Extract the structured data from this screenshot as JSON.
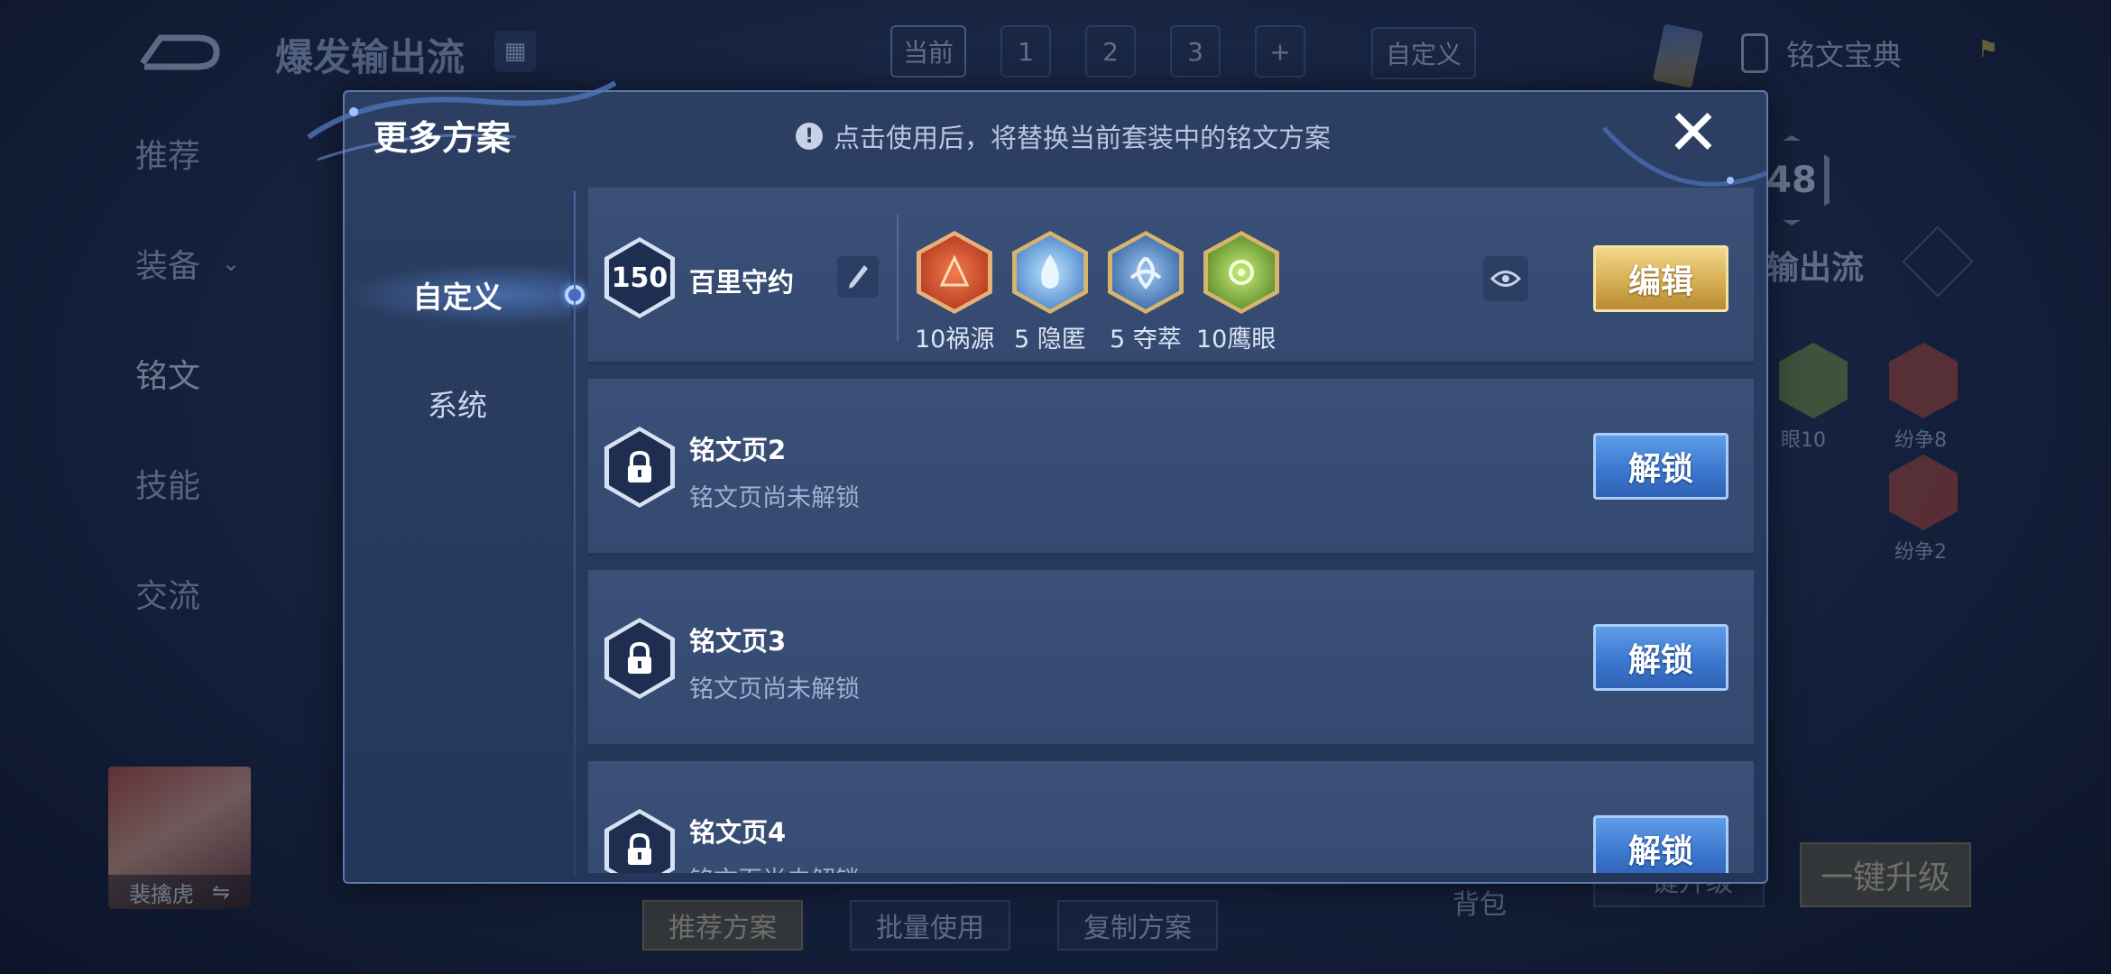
{
  "background": {
    "title": "爆发输出流",
    "page_tabs": [
      "当前",
      "1",
      "2",
      "3",
      "+"
    ],
    "custom_tab": "自定义",
    "codex_label": "铭文宝典",
    "side_nav": [
      "推荐",
      "装备",
      "铭文",
      "技能",
      "交流"
    ],
    "hero_name": "裴擒虎",
    "hero_swap_icon": "⇋",
    "bottom_buttons": [
      "推荐方案",
      "批量使用",
      "复制方案"
    ],
    "bag_label": "背包",
    "upgrade_label": "一键升级",
    "upgrade_label_partial": "一键升级",
    "right_level": "48",
    "right_title": "输出流",
    "right_gems": [
      {
        "label": "眼10",
        "color": "#6f8f3a"
      },
      {
        "label": "纷争8",
        "color": "#a84230"
      },
      {
        "label": "纷争2",
        "color": "#a84230"
      }
    ]
  },
  "modal": {
    "title": "更多方案",
    "note": "点击使用后，将替换当前套装中的铭文方案",
    "close_icon": "close-icon",
    "nav": [
      {
        "label": "自定义",
        "active": true
      },
      {
        "label": "系统",
        "active": false
      }
    ],
    "pages": [
      {
        "level": "150",
        "name": "百里守约",
        "runes": [
          {
            "label": "10祸源",
            "color": "#c9502f",
            "icon": "red-rune-icon"
          },
          {
            "label": "5 隐匿",
            "color": "#5b8fd0",
            "icon": "blue-rune-icon"
          },
          {
            "label": "5 夺萃",
            "color": "#4f78b4",
            "icon": "blue-knot-rune-icon"
          },
          {
            "label": "10鹰眼",
            "color": "#7ea83a",
            "icon": "green-rune-icon"
          }
        ],
        "action": "编辑"
      },
      {
        "name": "铭文页2",
        "sub": "铭文页尚未解锁",
        "action": "解锁"
      },
      {
        "name": "铭文页3",
        "sub": "铭文页尚未解锁",
        "action": "解锁"
      },
      {
        "name": "铭文页4",
        "sub": "铭文页尚未解锁",
        "action": "解锁"
      }
    ]
  },
  "colors": {
    "accent_gold": "#d6ae54",
    "accent_blue": "#3d78cf",
    "panel": "#2c3f63"
  }
}
